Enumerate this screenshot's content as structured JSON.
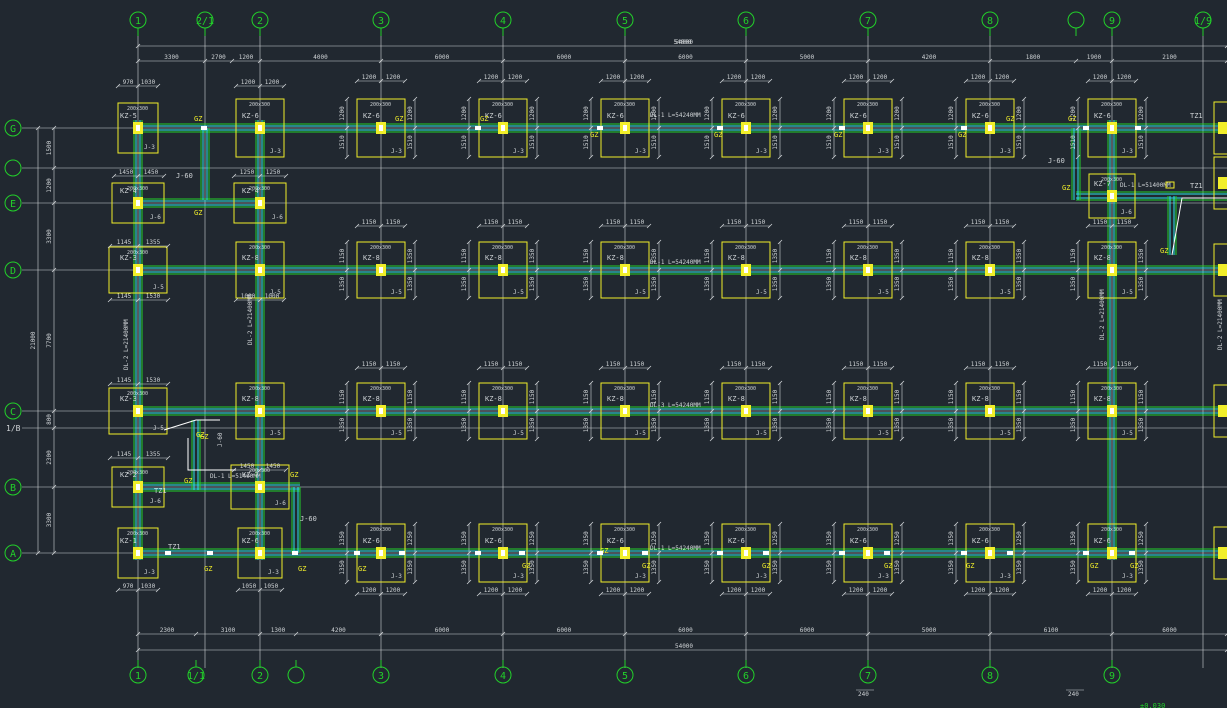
{
  "drawing": {
    "columns_top": [
      "1",
      "2/1",
      "2",
      "3",
      "4",
      "5",
      "6",
      "7",
      "8",
      "",
      "9",
      "1/9"
    ],
    "columns_bottom": [
      "1",
      "1/1",
      "2",
      "",
      "3",
      "4",
      "5",
      "6",
      "7",
      "8",
      "9"
    ],
    "rows": [
      "G",
      "",
      "E",
      "D",
      "C",
      "1/B",
      "B",
      "A"
    ],
    "dim_top_total": "54000",
    "dim_top": [
      "3300",
      "2700",
      "1200",
      "4000",
      "6000",
      "6000",
      "6000",
      "5000",
      "4200",
      "1800",
      "1900",
      "2100"
    ],
    "dim_bottom_total": "54000",
    "dim_bottom": [
      "2300",
      "3100",
      "1300",
      "4200",
      "6000",
      "6000",
      "6000",
      "6000",
      "5000",
      "6100",
      "6000"
    ],
    "dim_left": [
      "1500",
      "1200",
      "3300",
      "7700",
      "800",
      "2300",
      "3300"
    ],
    "dim_left_total": "21000",
    "footing_pair_dims": [
      "1200",
      "1200"
    ],
    "footing_pair_dims_mid": [
      "1150",
      "1150"
    ],
    "beam_labels": [
      "DL-1 L=54240MM",
      "DL-3 L=54240MM",
      "DL-1 L=54240MM",
      "DL-1 L=51400MM",
      "DL-2 L=21400MM",
      "DL-2 L=21400MM",
      "DL-2 L=21400MM",
      "DL-1 L=51400MM"
    ],
    "stair_labels": [
      "J-60",
      "J-60",
      "J-60",
      "J-60"
    ],
    "tz_labels": [
      "TZ1",
      "TZ1",
      "TZ1",
      "TZ1"
    ],
    "gz": "GZ",
    "kz": {
      "A": "KZ-6",
      "B": "KZ-8",
      "C": "KZ-8",
      "D": "KZ-8",
      "G": "KZ-6",
      "E": "KZ-4"
    },
    "j": {
      "A": "J-3",
      "B": "J-5",
      "C": "J-5",
      "D": "J-5",
      "G": "J-3",
      "E": "J-6"
    },
    "col_size": "200x300",
    "bottom_fragment": "240",
    "bottom_note": "±0.030"
  }
}
